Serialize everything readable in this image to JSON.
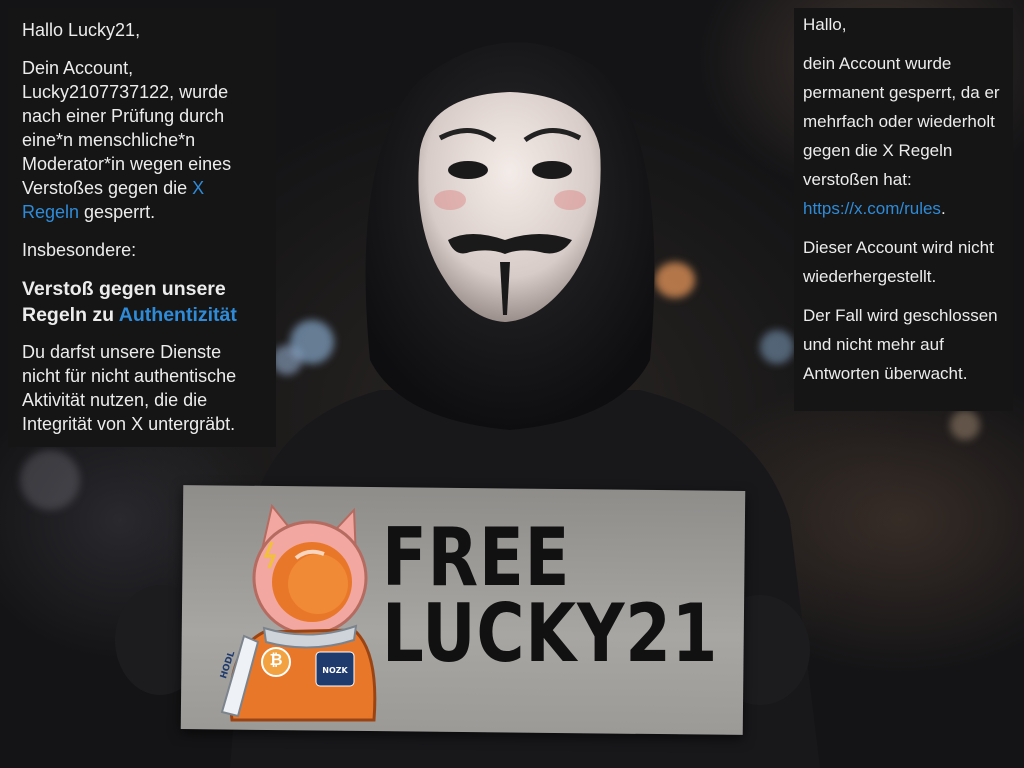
{
  "left_panel": {
    "greeting": "Hallo Lucky21,",
    "para1_pre": "Dein Account, Lucky2107737122, wurde nach einer Prüfung durch eine*n menschliche*n Moderator*in wegen eines Verstoßes gegen die ",
    "para1_link": "X Regeln",
    "para1_post": " gesperrt.",
    "insbesondere": "Insbesondere:",
    "heading_pre": "Verstoß gegen unsere Regeln zu ",
    "heading_link": "Authentizität",
    "para2": "Du darfst unsere Dienste nicht für nicht authentische Aktivität nutzen, die die Integrität von X untergräbt."
  },
  "right_panel": {
    "greeting": "Hallo,",
    "para1_pre": "dein Account wurde permanent gesperrt, da er mehrfach oder wiederholt gegen die X Regeln verstoßen hat: ",
    "para1_link": "https://x.com/rules",
    "para1_post": ".",
    "para2": "Dieser Account wird nicht wiederhergestellt.",
    "para3": "Der Fall wird geschlossen und nicht mehr auf Antworten überwacht."
  },
  "sign": {
    "line1": "FREE",
    "line2": "LUCKY21",
    "patch_text": "NOZK",
    "sleeve_text": "HODL",
    "bitcoin_symbol": "₿"
  },
  "colors": {
    "link": "#2f8bd8",
    "panel_bg": "#151515",
    "suit_orange": "#e8772a",
    "helmet_pink": "#f2a7a0"
  }
}
